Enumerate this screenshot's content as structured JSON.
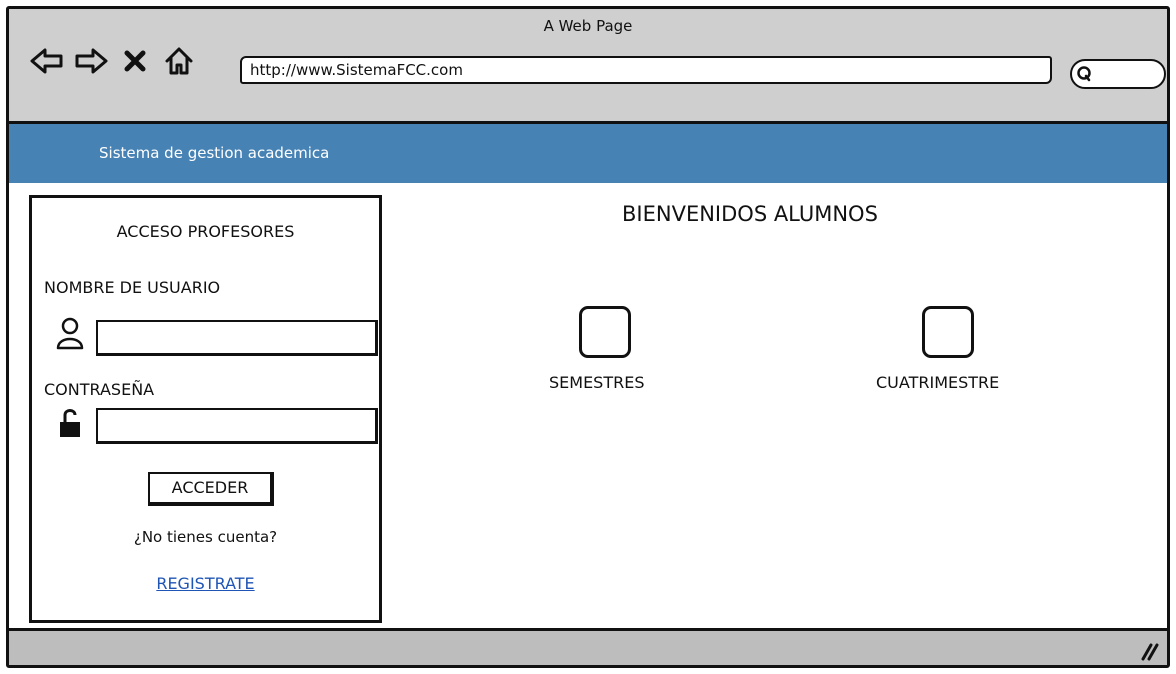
{
  "window": {
    "title": "A Web Page",
    "url": "http://www.SistemaFCC.com"
  },
  "icons": {
    "back": "back-arrow-icon",
    "forward": "forward-arrow-icon",
    "stop": "close-icon",
    "home": "home-icon",
    "search": "search-icon",
    "user": "user-icon",
    "lock": "unlock-icon",
    "resize": "resize-grip-icon"
  },
  "header": {
    "title": "Sistema de gestion academica",
    "color": "#4682b4"
  },
  "login": {
    "title": "ACCESO PROFESORES",
    "username_label": "NOMBRE DE USUARIO",
    "username_value": "",
    "password_label": "CONTRASEÑA",
    "password_value": "",
    "submit_label": "ACCEDER",
    "no_account_text": "¿No tienes cuenta?",
    "register_label": "REGISTRATE",
    "link_color": "#1f55b5"
  },
  "main": {
    "welcome": "BIENVENIDOS ALUMNOS",
    "tiles": [
      {
        "label": "SEMESTRES"
      },
      {
        "label": "CUATRIMESTRE"
      }
    ]
  }
}
